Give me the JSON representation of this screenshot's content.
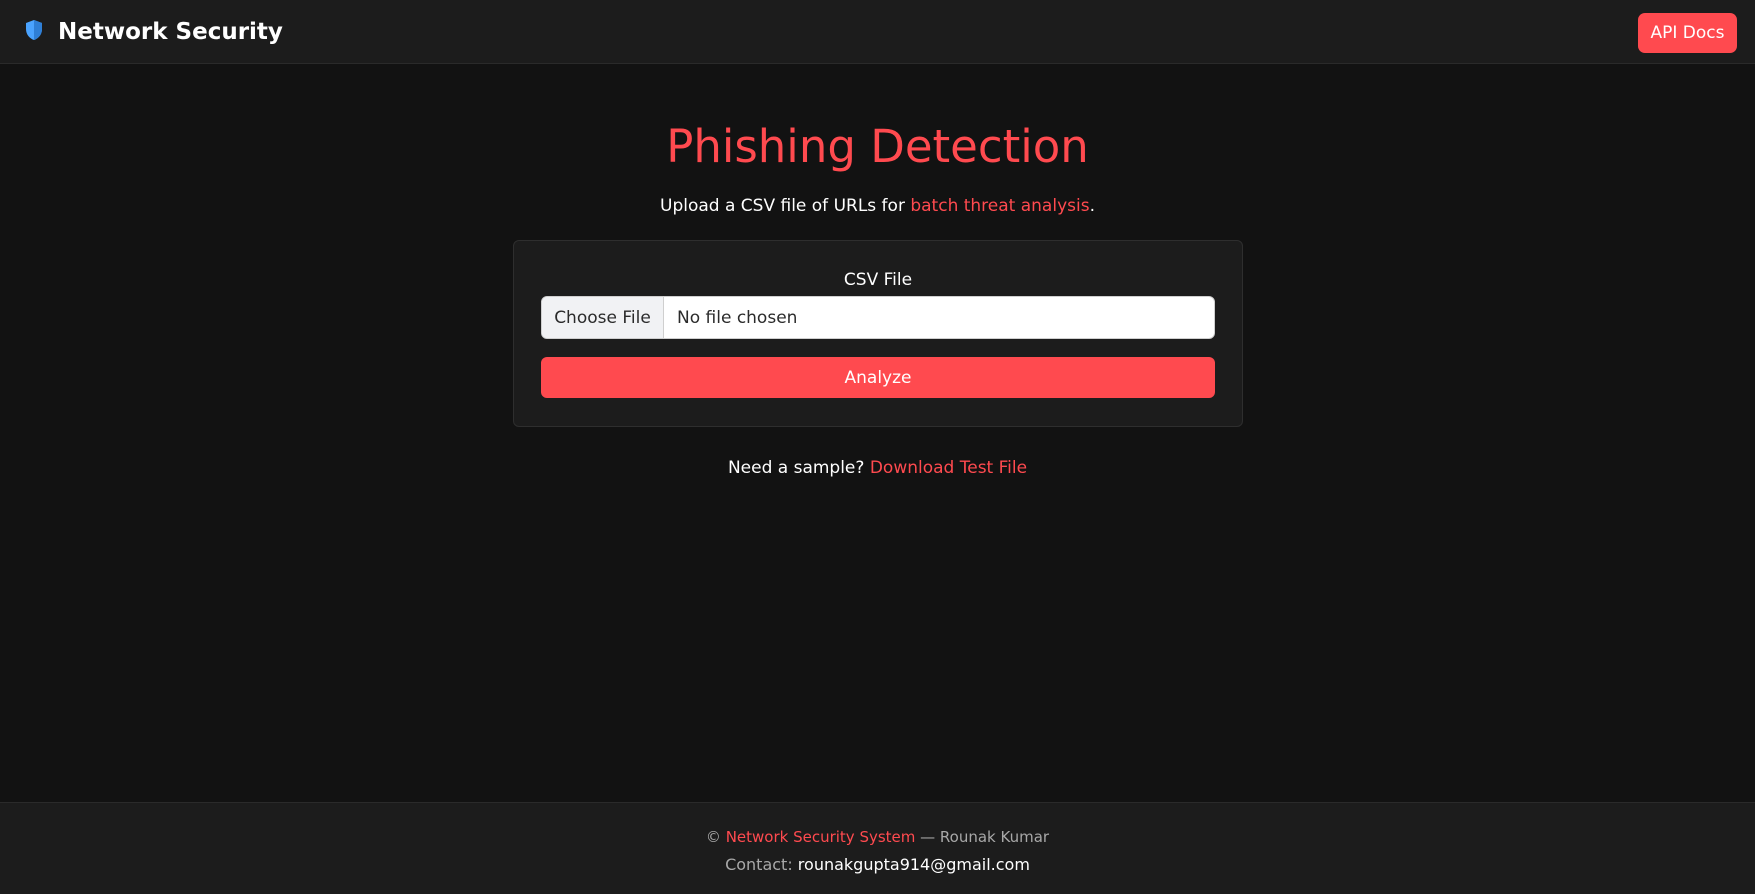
{
  "nav": {
    "brand_icon": "shield-icon",
    "brand_title": "Network Security",
    "api_docs_label": "API Docs"
  },
  "main": {
    "title": "Phishing Detection",
    "subtitle_prefix": "Upload a CSV file of URLs for ",
    "subtitle_accent": "batch threat analysis",
    "subtitle_suffix": ".",
    "form": {
      "file_label": "CSV File",
      "choose_file_label": "Choose File",
      "file_status": "No file chosen",
      "analyze_label": "Analyze"
    },
    "sample_prefix": "Need a sample? ",
    "sample_link": "Download Test File"
  },
  "footer": {
    "copyright_symbol": "©",
    "system_name": "Network Security System",
    "author": " — Rounak Kumar",
    "contact_label": "Contact: ",
    "contact_email": "rounakgupta914@gmail.com"
  },
  "colors": {
    "accent": "#ff4a4f",
    "background": "#121212",
    "surface": "#1c1c1c",
    "shield": "#4aa3ff"
  }
}
